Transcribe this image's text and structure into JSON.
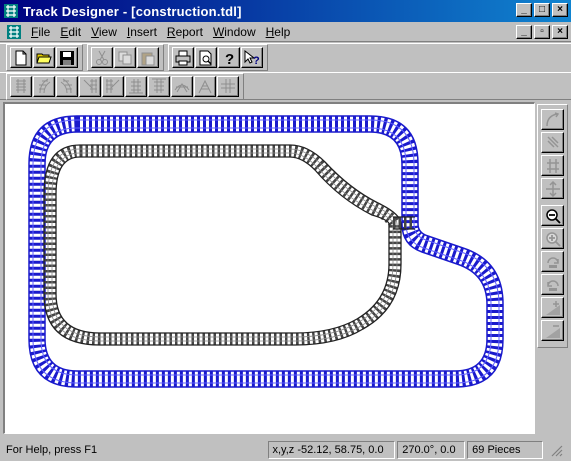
{
  "window": {
    "title": "Track Designer - [construction.tdl]",
    "minimize_glyph": "_",
    "maximize_glyph": "□",
    "close_glyph": "×",
    "restore_glyph": "▫"
  },
  "menu": {
    "items": [
      {
        "name": "file",
        "label": "File",
        "accel": "F",
        "rest": "ile"
      },
      {
        "name": "edit",
        "label": "Edit",
        "accel": "E",
        "rest": "dit"
      },
      {
        "name": "view",
        "label": "View",
        "accel": "V",
        "rest": "iew"
      },
      {
        "name": "insert",
        "label": "Insert",
        "accel": "I",
        "rest": "nsert"
      },
      {
        "name": "report",
        "label": "Report",
        "accel": "R",
        "rest": "eport"
      },
      {
        "name": "window",
        "label": "Window",
        "accel": "W",
        "rest": "indow"
      },
      {
        "name": "help",
        "label": "Help",
        "accel": "H",
        "rest": "elp"
      }
    ]
  },
  "toolbar": {
    "new_icon": "new-document-icon",
    "open_icon": "open-folder-icon",
    "save_icon": "save-floppy-icon",
    "cut_icon": "cut-scissors-icon",
    "copy_icon": "copy-icon",
    "paste_icon": "paste-icon",
    "print_icon": "print-icon",
    "preview_icon": "print-preview-icon",
    "about_icon": "help-question-icon",
    "context_help_icon": "context-help-icon"
  },
  "track_toolbar": {
    "pieces": [
      "straight-track-icon",
      "curve-track-left-icon",
      "curve-track-right-icon",
      "switch-left-icon",
      "switch-right-icon",
      "ramp-up-icon",
      "ramp-down-icon",
      "bridge-icon",
      "crossing-icon",
      "crossover-icon"
    ]
  },
  "right_toolbar": {
    "tools": [
      "rotate-curve-icon",
      "flip-icon",
      "join-icon",
      "move-icon",
      "zoom-out-icon",
      "zoom-in-icon",
      "rotate-cw-icon",
      "rotate-ccw-icon",
      "raise-icon",
      "lower-icon"
    ]
  },
  "status": {
    "help": "For Help, press F1",
    "xyz": "x,y,z -52.12, 58.75, 0.0",
    "angle": "270.0°, 0.0",
    "pieces": "69 Pieces"
  },
  "colors": {
    "title_active": "#000080",
    "outer_track": "#1a1acc",
    "inner_track": "#555555",
    "face": "#c0c0c0"
  }
}
